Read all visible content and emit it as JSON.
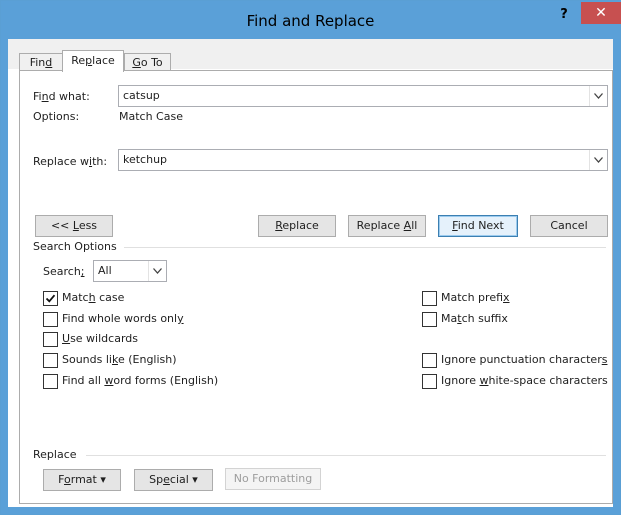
{
  "window": {
    "title": "Find and Replace",
    "help_label": "?",
    "close_label": "✕"
  },
  "tabs": [
    {
      "label_pre": "Fin",
      "label_key": "d",
      "label_post": ""
    },
    {
      "label_pre": "Re",
      "label_key": "p",
      "label_post": "lace"
    },
    {
      "label_pre": "",
      "label_key": "G",
      "label_post": "o To"
    }
  ],
  "find": {
    "label_pre": "Fi",
    "label_key": "n",
    "label_post": "d what:",
    "value": "catsup",
    "options_label": "Options:",
    "options_value": "Match Case"
  },
  "replace": {
    "label_pre": "Replace w",
    "label_key": "i",
    "label_post": "th:",
    "value": "ketchup"
  },
  "buttons": {
    "less_pre": "<< ",
    "less_key": "L",
    "less_post": "ess",
    "replace_pre": "",
    "replace_key": "R",
    "replace_post": "eplace",
    "replace_all_pre": "Replace ",
    "replace_all_key": "A",
    "replace_all_post": "ll",
    "find_next_pre": "",
    "find_next_key": "F",
    "find_next_post": "ind Next",
    "cancel": "Cancel"
  },
  "search_options": {
    "heading": "Search Options",
    "search_label_pre": "Search",
    "search_label_key": ";",
    "search_label_post": "",
    "search_value": "All"
  },
  "checkboxes_left": [
    {
      "pre": "Matc",
      "key": "h",
      "post": " case",
      "checked": true
    },
    {
      "pre": "Find whole words onl",
      "key": "y",
      "post": "",
      "checked": false
    },
    {
      "pre": "",
      "key": "U",
      "post": "se wildcards",
      "checked": false
    },
    {
      "pre": "Sounds li",
      "key": "k",
      "post": "e (English)",
      "checked": false
    },
    {
      "pre": "Find all ",
      "key": "w",
      "post": "ord forms (English)",
      "checked": false
    }
  ],
  "checkboxes_right": [
    {
      "pre": "Match prefi",
      "key": "x",
      "post": "",
      "checked": false
    },
    {
      "pre": "Ma",
      "key": "t",
      "post": "ch suffix",
      "checked": false
    },
    {
      "pre": "Ignore punctuation character",
      "key": "s",
      "post": "",
      "checked": false
    },
    {
      "pre": "Ignore ",
      "key": "w",
      "post": "hite-space characters",
      "checked": false
    }
  ],
  "replace_section": {
    "heading": "Replace",
    "format_pre": "F",
    "format_key": "o",
    "format_post": "rmat ▾",
    "special_pre": "Sp",
    "special_key": "e",
    "special_post": "cial ▾",
    "no_formatting": "No Formatting"
  },
  "colors": {
    "title_bar": "#5aa0d8",
    "close_button": "#c75050",
    "default_button_border": "#3c7fb1"
  }
}
